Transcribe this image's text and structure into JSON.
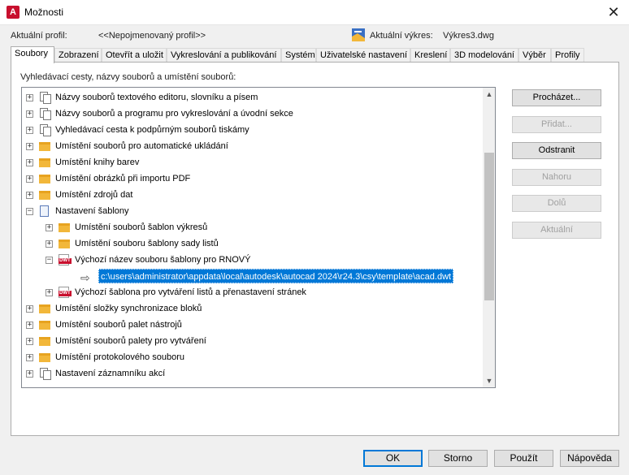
{
  "window": {
    "title": "Možnosti",
    "close_glyph": "✕"
  },
  "profile": {
    "label": "Aktuální profil:",
    "value": "<<Nepojmenovaný profil>>"
  },
  "drawing": {
    "label": "Aktuální výkres:",
    "value": "Výkres3.dwg"
  },
  "tabs": [
    "Soubory",
    "Zobrazení",
    "Otevřít a uložit",
    "Vykreslování a publikování",
    "Systém",
    "Uživatelské nastavení",
    "Kreslení",
    "3D modelování",
    "Výběr",
    "Profily"
  ],
  "panel": {
    "label": "Vyhledávací cesty, názvy souborů a umístění souborů:"
  },
  "tree": [
    {
      "label": "Názvy souborů textového editoru, slovníku a písem",
      "icon": "multi-doc-icon",
      "level": 0,
      "expander": "+"
    },
    {
      "label": "Názvy souborů a programu pro vykreslování a úvodní sekce",
      "icon": "multi-doc-icon",
      "level": 0,
      "expander": "+"
    },
    {
      "label": "Vyhledávací cesta k podpůrným souborů tiskámy",
      "icon": "multi-doc-icon",
      "level": 0,
      "expander": "+"
    },
    {
      "label": "Umístění souborů pro automatické ukládání",
      "icon": "folder-icon",
      "level": 0,
      "expander": "+"
    },
    {
      "label": "Umístění knihy barev",
      "icon": "folder-icon",
      "level": 0,
      "expander": "+"
    },
    {
      "label": "Umístění obrázků při importu PDF",
      "icon": "folder-icon",
      "level": 0,
      "expander": "+"
    },
    {
      "label": "Umístění zdrojů dat",
      "icon": "folder-icon",
      "level": 0,
      "expander": "+"
    },
    {
      "label": "Nastavení šablony",
      "icon": "document-icon",
      "level": 0,
      "expander": "−"
    },
    {
      "label": "Umístění souborů šablon výkresů",
      "icon": "folder-icon",
      "level": 1,
      "expander": "+"
    },
    {
      "label": "Umístění souboru šablony sady listů",
      "icon": "folder-icon",
      "level": 1,
      "expander": "+"
    },
    {
      "label": "Výchozí název souboru šablony pro RNOVÝ",
      "icon": "dwt-file-icon",
      "level": 1,
      "expander": "−"
    },
    {
      "label": "c:\\users\\administrator\\appdata\\local\\autodesk\\autocad 2024\\r24.3\\csy\\template\\acad.dwt",
      "icon": "arrow-icon",
      "level": 2,
      "expander": "",
      "selected": true
    },
    {
      "label": "Výchozí šablona pro vytváření listů a přenastavení stránek",
      "icon": "dwt-file-icon",
      "level": 1,
      "expander": "+"
    },
    {
      "label": "Umístění složky synchronizace bloků",
      "icon": "folder-icon",
      "level": 0,
      "expander": "+"
    },
    {
      "label": "Umístění souborů palet nástrojů",
      "icon": "folder-icon",
      "level": 0,
      "expander": "+"
    },
    {
      "label": "Umístění souborů palety pro vytváření",
      "icon": "folder-icon",
      "level": 0,
      "expander": "+"
    },
    {
      "label": "Umístění protokolového souboru",
      "icon": "folder-icon",
      "level": 0,
      "expander": "+"
    },
    {
      "label": "Nastavení záznamníku akcí",
      "icon": "multi-doc-icon",
      "level": 0,
      "expander": "+"
    }
  ],
  "side_buttons": [
    {
      "label": "Procházet...",
      "enabled": true
    },
    {
      "label": "Přidat...",
      "enabled": false
    },
    {
      "label": "Odstranit",
      "enabled": true
    },
    {
      "label": "Nahoru",
      "enabled": false
    },
    {
      "label": "Dolů",
      "enabled": false
    },
    {
      "label": "Aktuální",
      "enabled": false
    }
  ],
  "bottom_buttons": [
    {
      "label": "OK"
    },
    {
      "label": "Storno"
    },
    {
      "label": "Použít"
    },
    {
      "label": "Nápověda"
    }
  ],
  "colors": {
    "selection": "#0078d7",
    "app_icon": "#c8102e",
    "folder": "#f2b73a"
  }
}
